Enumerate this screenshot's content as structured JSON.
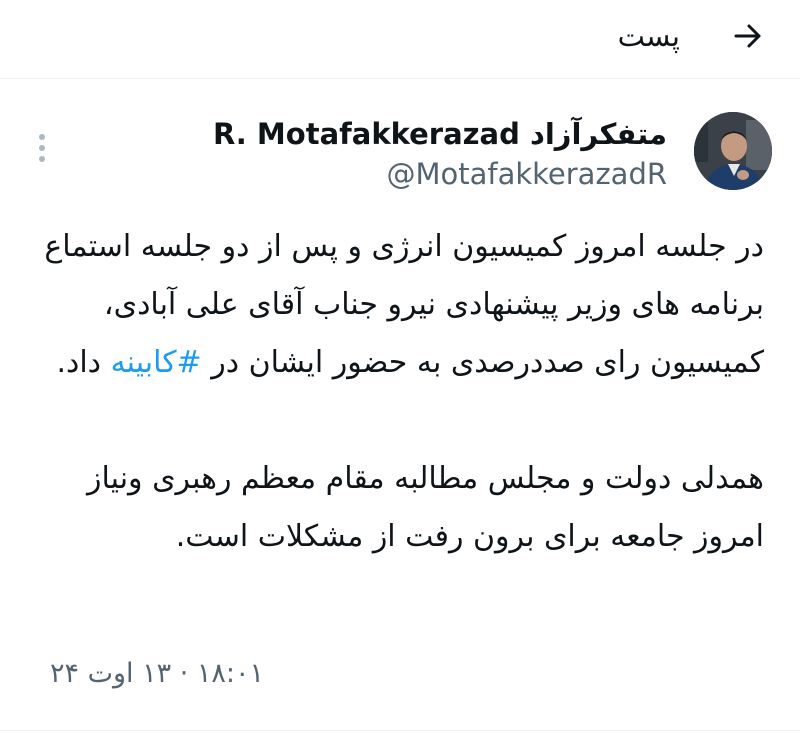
{
  "header": {
    "title": "پست",
    "back_icon": "arrow-right-icon"
  },
  "author": {
    "display_name": "R. Motafakkerazad",
    "display_name_fa": "متفکرآزاد",
    "handle": "@MotafakkerazadR"
  },
  "tweet": {
    "para1_before": "در جلسه امروز کمیسیون انرژی و پس از دو جلسه استماع برنامه های وزیر پیشنهادی نیرو جناب آقای علی آبادی، کمیسیون رای صددرصدی به حضور ایشان در ",
    "hashtag": "#کابینه",
    "para1_after": " داد.",
    "para2": "همدلی دولت و مجلس مطالبه مقام معظم رهبری ونیاز امروز جامعه برای برون رفت از مشکلات است."
  },
  "meta": {
    "time": "۱۸:۰۱",
    "date": "۱۳ اوت ۲۴"
  }
}
